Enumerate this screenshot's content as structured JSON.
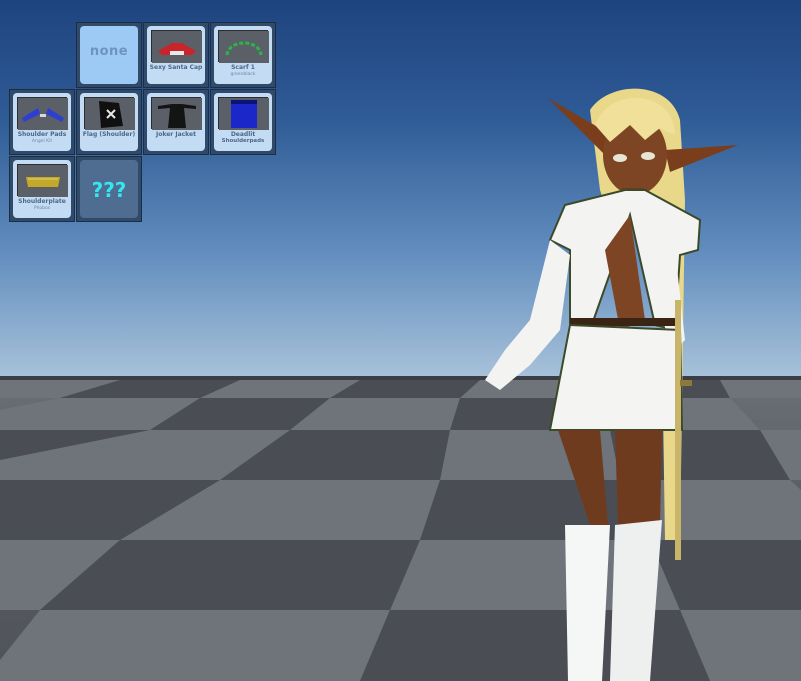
{
  "inventory": {
    "slots": [
      {
        "label": "none",
        "sub": ""
      },
      {
        "label": "Sexy Santa Cap",
        "sub": ""
      },
      {
        "label": "Scarf 1",
        "sub": "greenblack"
      },
      {
        "label": "Shoulder Pads",
        "sub": "Angel Kit"
      },
      {
        "label": "Flag (Shoulder)",
        "sub": ""
      },
      {
        "label": "Joker Jacket",
        "sub": ""
      },
      {
        "label": "Deadlit",
        "sub": "Shoulderpads"
      },
      {
        "label": "Shoulderplate",
        "sub": "Phobos"
      },
      {
        "label": "???",
        "sub": ""
      }
    ]
  },
  "colors": {
    "slot_bg": "#c3dcf4",
    "slot_selected": "#9ccaf5",
    "slot_empty": "#4e6d91",
    "mystery_text": "#37e5f0",
    "sky_top": "#1e447f",
    "floor": "#5a5e64"
  }
}
